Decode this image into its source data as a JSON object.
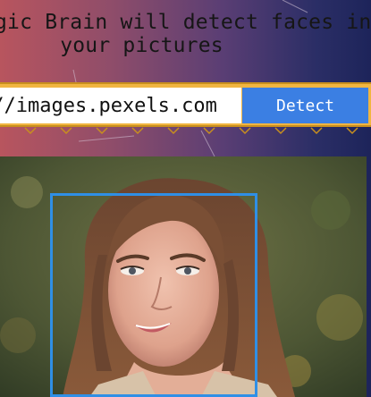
{
  "heading": {
    "line1": "gic Brain will detect faces in",
    "line2": "your pictures"
  },
  "form": {
    "url_value": "://images.pexels.com",
    "detect_label": "Detect"
  },
  "colors": {
    "accent_strip": "#f1b541",
    "button": "#3b7fe3",
    "face_box": "#2f8fe6"
  },
  "result": {
    "faces_detected": 1
  }
}
